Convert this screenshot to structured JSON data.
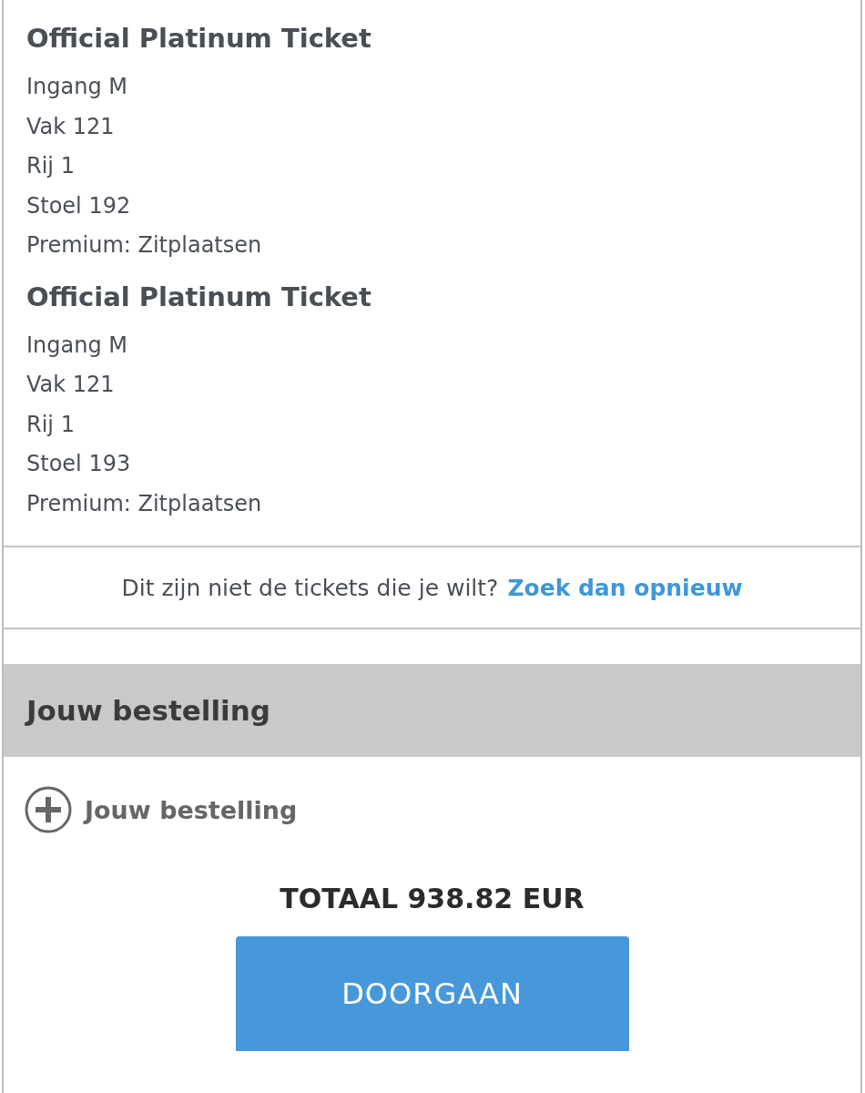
{
  "tickets": [
    {
      "title": "Official Platinum Ticket",
      "lines": [
        "Ingang M",
        "Vak 121",
        "Rij 1",
        "Stoel 192",
        "Premium: Zitplaatsen"
      ]
    },
    {
      "title": "Official Platinum Ticket",
      "lines": [
        "Ingang M",
        "Vak 121",
        "Rij 1",
        "Stoel 193",
        "Premium: Zitplaatsen"
      ]
    }
  ],
  "help": {
    "text": "Dit zijn niet de tickets die je wilt?",
    "link": "Zoek dan opnieuw"
  },
  "order": {
    "heading": "Jouw bestelling",
    "toggle": {
      "label": "Jouw bestelling",
      "expanded": false
    },
    "total": "TOTAAL 938.82 EUR",
    "button": "DOORGAAN"
  }
}
